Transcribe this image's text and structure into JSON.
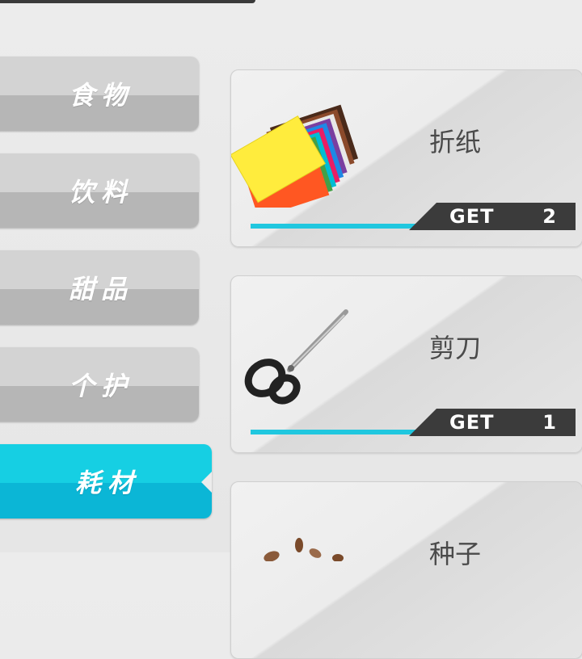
{
  "categories": [
    {
      "label": "食物",
      "active": false
    },
    {
      "label": "饮料",
      "active": false
    },
    {
      "label": "甜品",
      "active": false
    },
    {
      "label": "个护",
      "active": false
    },
    {
      "label": "耗材",
      "active": true
    }
  ],
  "items": [
    {
      "name": "折纸",
      "get_label": "GET",
      "count": "2",
      "icon": "colored-paper-icon"
    },
    {
      "name": "剪刀",
      "get_label": "GET",
      "count": "1",
      "icon": "scissors-icon"
    },
    {
      "name": "种子",
      "icon": "seeds-icon"
    }
  ],
  "colors": {
    "accent": "#16cfe3",
    "button_gray": "#d3d3d3",
    "tag_dark": "#3b3b3b"
  }
}
